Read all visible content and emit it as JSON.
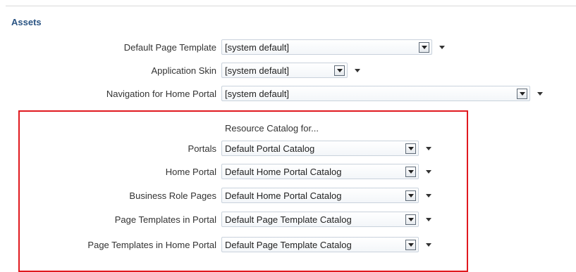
{
  "section_title": "Assets",
  "fields": [
    {
      "label": "Default Page Template",
      "value": "[system default]"
    },
    {
      "label": "Application Skin",
      "value": "[system default]"
    },
    {
      "label": "Navigation for Home Portal",
      "value": "[system default]"
    }
  ],
  "catalog": {
    "heading": "Resource Catalog for...",
    "rows": [
      {
        "label": "Portals",
        "value": "Default Portal Catalog"
      },
      {
        "label": "Home Portal",
        "value": "Default Home Portal Catalog"
      },
      {
        "label": "Business Role Pages",
        "value": "Default Home Portal Catalog"
      },
      {
        "label": "Page Templates in Portal",
        "value": "Default Page Template Catalog"
      },
      {
        "label": "Page Templates in Home Portal",
        "value": "Default Page Template Catalog"
      }
    ]
  },
  "colors": {
    "section_title": "#2a5483",
    "highlight_border": "#e0191f"
  },
  "icons": {
    "dropdown": "chevron-down-icon",
    "more_menu": "caret-down-icon"
  }
}
